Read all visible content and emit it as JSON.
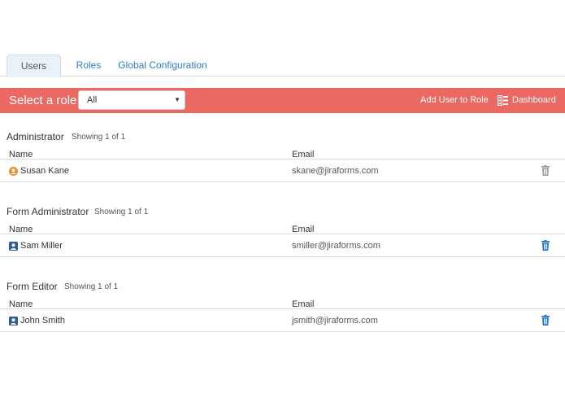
{
  "tabs": [
    {
      "label": "Users",
      "active": true
    },
    {
      "label": "Roles",
      "active": false
    },
    {
      "label": "Global Configuration",
      "active": false
    }
  ],
  "toolbar": {
    "title": "Select a role",
    "role_select": {
      "value": "All",
      "caret": "▼"
    },
    "add_user_label": "Add User to Role",
    "dashboard_label": "Dashboard",
    "dashboard_icon": "dashboard-list-icon",
    "background_color": "#eb6962"
  },
  "columns": {
    "name": "Name",
    "email": "Email"
  },
  "sections": [
    {
      "title": "Administrator",
      "count": "Showing 1 of 1",
      "users": [
        {
          "name": "Susan Kane",
          "email": "skane@jiraforms.com",
          "icon": "admin-avatar-icon",
          "delete_enabled": false
        }
      ]
    },
    {
      "title": "Form Administrator",
      "count": "Showing 1 of 1",
      "users": [
        {
          "name": "Sam Miller",
          "email": "smiller@jiraforms.com",
          "icon": "user-avatar-icon",
          "delete_enabled": true
        }
      ]
    },
    {
      "title": "Form Editor",
      "count": "Showing 1 of 1",
      "users": [
        {
          "name": "John Smith",
          "email": "jsmith@jiraforms.com",
          "icon": "user-avatar-icon",
          "delete_enabled": true
        }
      ]
    }
  ],
  "colors": {
    "link": "#2d7cc4",
    "trash_active": "#1f6fc5",
    "trash_disabled": "#9a9a9a",
    "admin_icon": "#f08a24",
    "user_icon": "#2f5f8f"
  }
}
